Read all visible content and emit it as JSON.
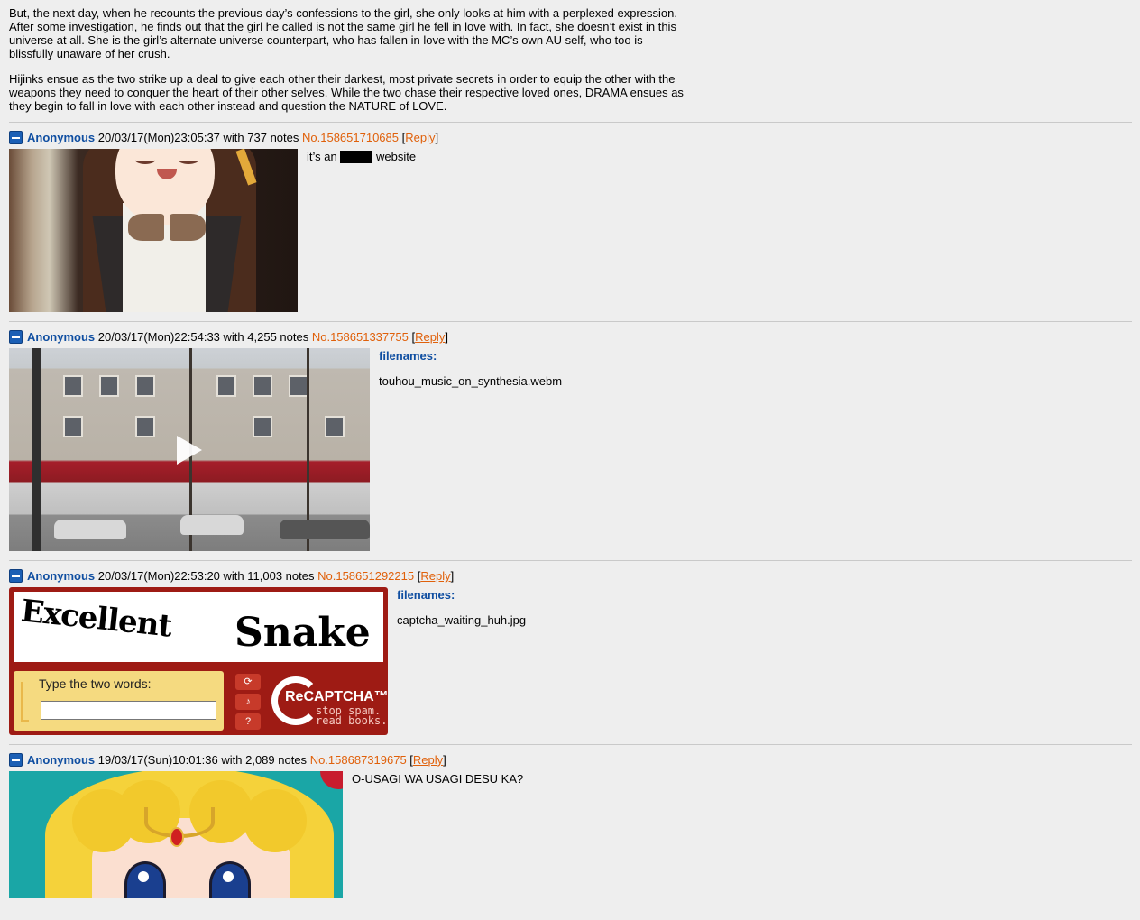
{
  "op": {
    "paragraph1": "But, the next day, when he recounts the previous day’s confessions to the girl, she only looks at him with a perplexed expression. After some investigation, he finds out that the girl he called is not the same girl he fell in love with. In fact, she doesn’t exist in this universe at all. She is the girl’s alternate universe counterpart, who has fallen in love with the MC’s own AU self, who too is blissfully unaware of her crush.",
    "paragraph2": "Hijinks ensue as the two strike up a deal to give each other their darkest, most private secrets in order to equip the other with the weapons they need to conquer the heart of their other selves. While the two chase their respective loved ones, DRAMA ensues as they begin to fall in love with each other instead and question the NATURE of LOVE."
  },
  "posts": [
    {
      "name": "Anonymous",
      "datetime": "20/03/17(Mon)23:05:37",
      "notes_text": "with 737 notes",
      "post_no": "No.158651710685",
      "reply_label": "Reply",
      "message_before": "it’s an",
      "message_after": "website",
      "image_icon": "anime-girl-thumbnail"
    },
    {
      "name": "Anonymous",
      "datetime": "20/03/17(Mon)22:54:33",
      "notes_text": "with 4,255 notes",
      "post_no": "No.158651337755",
      "reply_label": "Reply",
      "filenames_label": "filenames:",
      "filename": "touhou_music_on_synthesia.webm",
      "image_icon": "video-thumbnail"
    },
    {
      "name": "Anonymous",
      "datetime": "20/03/17(Mon)22:53:20",
      "notes_text": "with 11,003 notes",
      "post_no": "No.158651292215",
      "reply_label": "Reply",
      "filenames_label": "filenames:",
      "filename": "captcha_waiting_huh.jpg",
      "captcha": {
        "word1": "Excellent",
        "word2": "Snake",
        "prompt": "Type the two words:",
        "logo": "ReCAPTCHA™",
        "tagline1": "stop spam.",
        "tagline2": "read books."
      }
    },
    {
      "name": "Anonymous",
      "datetime": "19/03/17(Sun)10:01:36",
      "notes_text": "with 2,089 notes",
      "post_no": "No.158687319675",
      "reply_label": "Reply",
      "message": "O-USAGI WA USAGI DESU KA?",
      "image_icon": "sailor-moon-thumbnail"
    }
  ],
  "colors": {
    "background": "#eeeeee",
    "name": "#0f4ea1",
    "post_no": "#e0600a",
    "separator": "#c9c9c9"
  }
}
